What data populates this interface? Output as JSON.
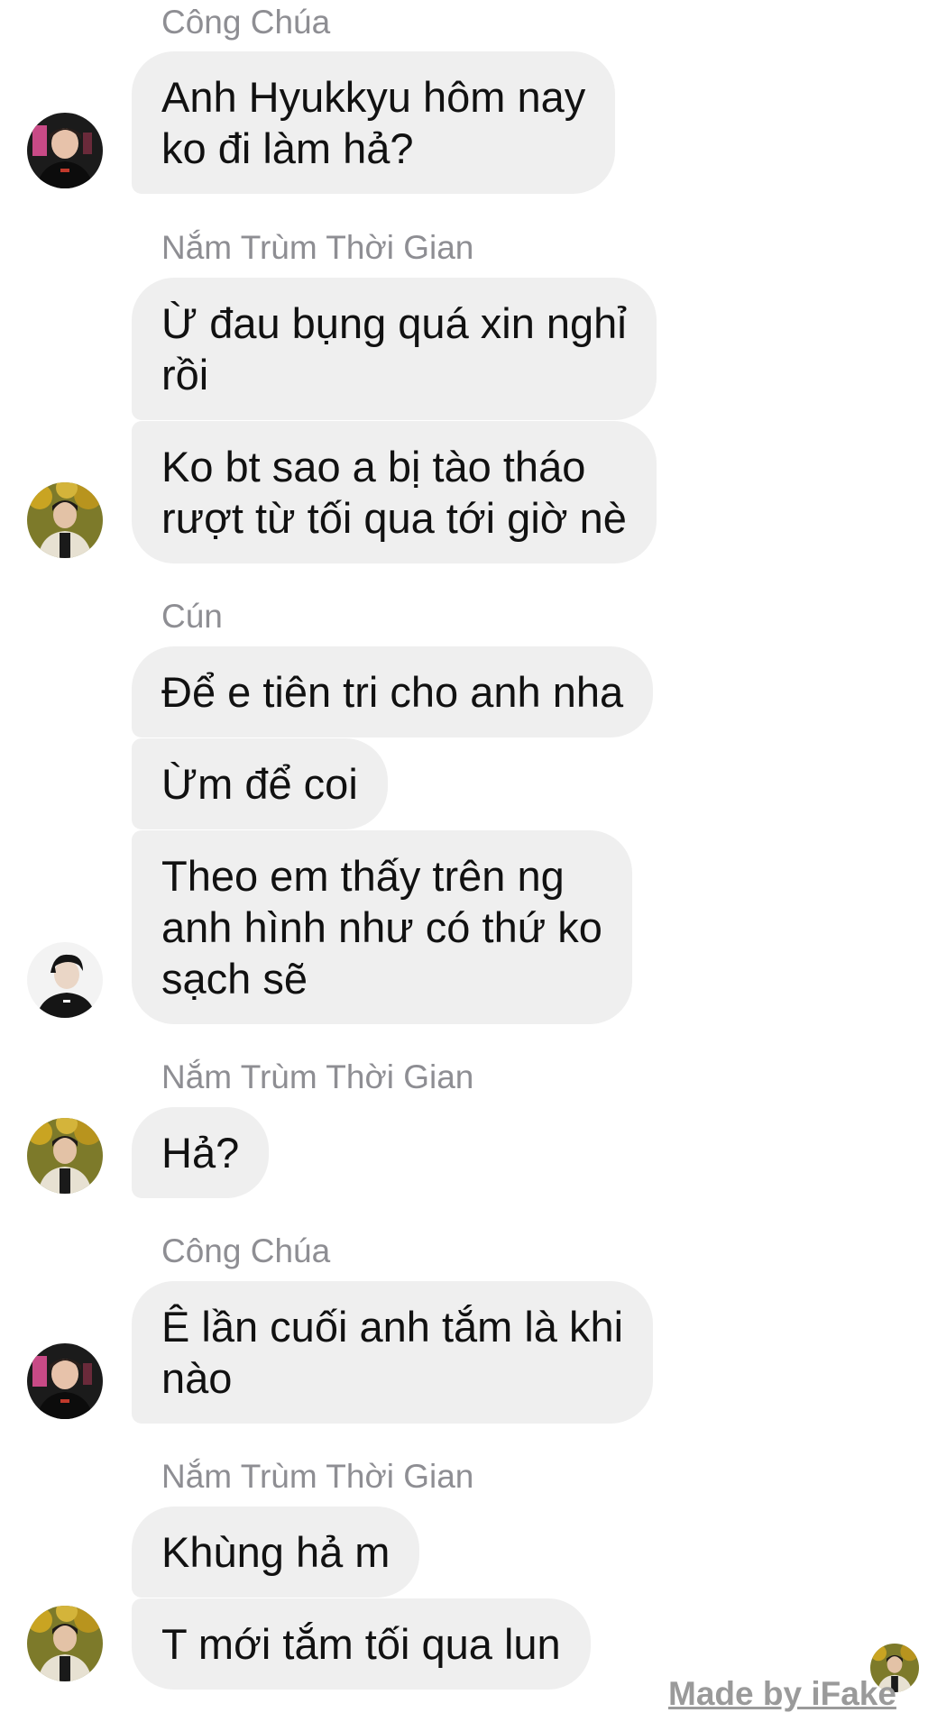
{
  "conversation": {
    "groups": [
      {
        "sender": "Công Chúa",
        "avatar": "avatar-cong-chua",
        "messages": [
          {
            "lines": [
              "Anh Hyukkyu hôm nay",
              "ko đi làm hả?"
            ]
          }
        ]
      },
      {
        "sender": "Nắm Trùm Thời Gian",
        "avatar": "avatar-nam-trum-thoi-gian",
        "messages": [
          {
            "lines": [
              "Ừ đau bụng quá xin nghỉ",
              "rồi"
            ]
          },
          {
            "lines": [
              "Ko bt sao a bị tào tháo",
              "rượt từ tối qua tới giờ nè"
            ]
          }
        ]
      },
      {
        "sender": "Cún",
        "avatar": "avatar-cun",
        "messages": [
          {
            "lines": [
              "Để e tiên tri cho anh nha"
            ]
          },
          {
            "lines": [
              "Ừm để coi"
            ]
          },
          {
            "lines": [
              "Theo em thấy trên ng",
              "anh hình như có thứ ko",
              "sạch sẽ"
            ]
          }
        ]
      },
      {
        "sender": "Nắm Trùm Thời Gian",
        "avatar": "avatar-nam-trum-thoi-gian",
        "messages": [
          {
            "lines": [
              "Hả?"
            ]
          }
        ]
      },
      {
        "sender": "Công Chúa",
        "avatar": "avatar-cong-chua",
        "messages": [
          {
            "lines": [
              "Ê lần cuối anh tắm là khi",
              "nào"
            ]
          }
        ]
      },
      {
        "sender": "Nắm Trùm Thời Gian",
        "avatar": "avatar-nam-trum-thoi-gian",
        "messages": [
          {
            "lines": [
              "Khùng hả m"
            ]
          },
          {
            "lines": [
              "T mới tắm tối qua lun"
            ]
          }
        ]
      }
    ]
  },
  "watermark": "Made by iFake",
  "colors": {
    "bubble_bg": "#efefef",
    "text": "#111111",
    "sender": "#8e8e93",
    "background": "#ffffff",
    "watermark": "#9a9a9a"
  }
}
